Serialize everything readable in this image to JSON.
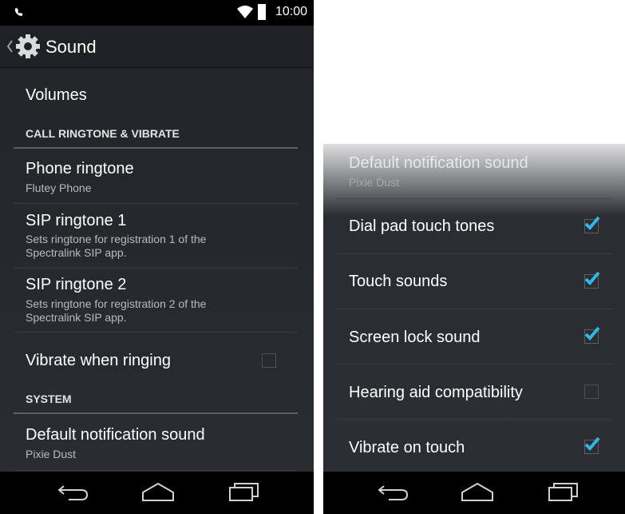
{
  "status": {
    "time": "10:00"
  },
  "header": {
    "title": "Sound"
  },
  "left": {
    "volumes": "Volumes",
    "section_call": "CALL RINGTONE & VIBRATE",
    "phone_ringtone": {
      "title": "Phone ringtone",
      "sub": "Flutey Phone"
    },
    "sip1": {
      "title": "SIP ringtone 1",
      "sub": "Sets ringtone for registration 1 of the Spectralink SIP app."
    },
    "sip2": {
      "title": "SIP ringtone 2",
      "sub": "Sets ringtone for registration 2 of the Spectralink SIP app."
    },
    "vibrate_ringing": {
      "title": "Vibrate when ringing",
      "checked": false
    },
    "section_system": "SYSTEM",
    "default_notif": {
      "title": "Default notification sound",
      "sub": "Pixie Dust"
    }
  },
  "right": {
    "default_notif": {
      "title": "Default notification sound",
      "sub": "Pixie Dust"
    },
    "dialpad": {
      "title": "Dial pad touch tones",
      "checked": true
    },
    "touch": {
      "title": "Touch sounds",
      "checked": true
    },
    "screenlock": {
      "title": "Screen lock sound",
      "checked": true
    },
    "hearing": {
      "title": "Hearing aid compatibility",
      "checked": false
    },
    "vibrate_touch": {
      "title": "Vibrate on touch",
      "checked": true
    }
  },
  "icons": {
    "accent": "#33b5e5"
  }
}
